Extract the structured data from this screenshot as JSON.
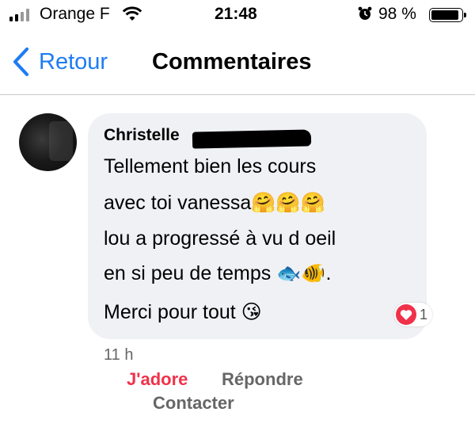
{
  "status_bar": {
    "carrier": "Orange F",
    "time": "21:48",
    "battery": "98 %",
    "battery_level": 0.98
  },
  "nav": {
    "back_label": "Retour",
    "title": "Commentaires"
  },
  "comment": {
    "author": "Christelle",
    "lines": [
      "Tellement bien les cours",
      "avec toi vanessa🤗🤗🤗",
      "lou a progressé à vu d oeil",
      "en si peu de temps 🐟🐠.",
      "Merci pour tout 😘"
    ],
    "reaction_count": "1",
    "time": "11 h",
    "actions": {
      "like": "J'adore",
      "reply": "Répondre",
      "contact": "Contacter"
    }
  },
  "colors": {
    "accent_blue": "#1e7cf2",
    "like_red": "#f0314a",
    "bubble_gray": "#f0f1f5"
  },
  "icons": {
    "signal": "signal-bars-icon",
    "wifi": "wifi-icon",
    "alarm": "alarm-clock-icon",
    "battery": "battery-icon",
    "back": "chevron-left-icon",
    "heart": "heart-icon"
  }
}
